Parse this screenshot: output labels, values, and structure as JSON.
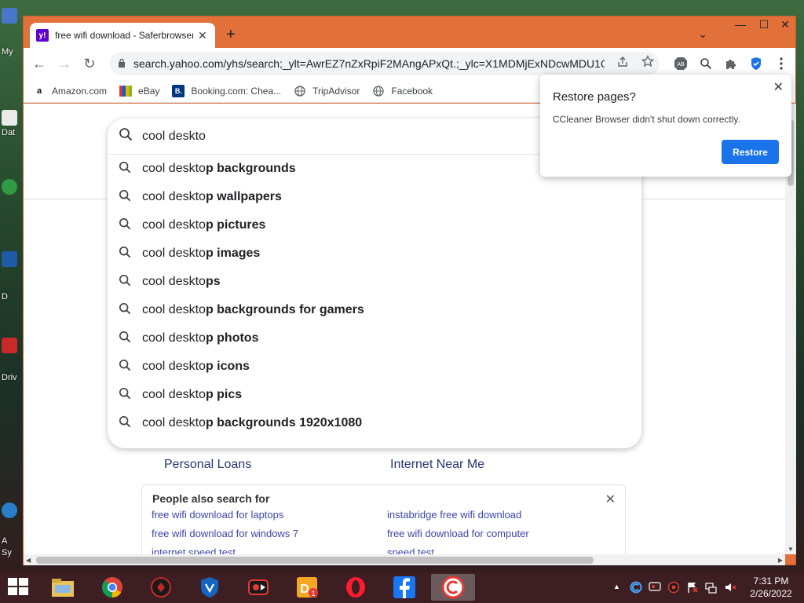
{
  "desktop": {
    "labels": [
      "My",
      "Dat",
      "D",
      "Driv",
      "A",
      "Sy"
    ]
  },
  "tab": {
    "favicon": "y!",
    "title": "free wifi download - Saferbrowser",
    "close": "✕",
    "new_tab": "+"
  },
  "window_controls": {
    "tab_search": "⌄",
    "minimize": "—",
    "maximize": "☐",
    "close": "✕"
  },
  "toolbar": {
    "back": "←",
    "forward": "→",
    "reload": "↻",
    "url": "search.yahoo.com/yhs/search;_ylt=AwrEZ7nZxRpiF2MAngAPxQt.;_ylc=X1MDMjExNDcwMDU1O..."
  },
  "bookmarks": [
    {
      "label": "Amazon.com",
      "icon": "a"
    },
    {
      "label": "eBay",
      "icon": "ebay-icon"
    },
    {
      "label": "Booking.com: Chea...",
      "icon": "B."
    },
    {
      "label": "TripAdvisor",
      "icon": "globe-icon"
    },
    {
      "label": "Facebook",
      "icon": "globe-icon"
    }
  ],
  "search": {
    "value": "cool deskto",
    "suggestions": [
      {
        "prefix": "cool deskto",
        "bold": "p backgrounds"
      },
      {
        "prefix": "cool deskto",
        "bold": "p wallpapers"
      },
      {
        "prefix": "cool deskto",
        "bold": "p pictures"
      },
      {
        "prefix": "cool deskto",
        "bold": "p images"
      },
      {
        "prefix": "cool deskto",
        "bold": "ps"
      },
      {
        "prefix": "cool deskto",
        "bold": "p backgrounds for gamers"
      },
      {
        "prefix": "cool deskto",
        "bold": "p photos"
      },
      {
        "prefix": "cool deskto",
        "bold": "p icons"
      },
      {
        "prefix": "cool deskto",
        "bold": "p pics"
      },
      {
        "prefix": "cool deskto",
        "bold": "p backgrounds 1920x1080"
      }
    ]
  },
  "page": {
    "link_left": "Personal Loans",
    "link_right": "Internet Near Me",
    "people_also_search": {
      "title": "People also search for",
      "close": "✕",
      "items": [
        "free wifi download for laptops",
        "instabridge free wifi download",
        "free wifi download for windows 7",
        "free wifi download for computer",
        "internet speed test",
        "speed test"
      ]
    }
  },
  "popup": {
    "title": "Restore pages?",
    "message": "CCleaner Browser didn't shut down correctly.",
    "button": "Restore",
    "close": "✕"
  },
  "taskbar": {
    "time": "7:31 PM",
    "date": "2/26/2022"
  },
  "colors": {
    "window_frame": "#e2703a",
    "accent_blue": "#1a73e8",
    "yahoo_purple": "#6001d2",
    "link_color": "#26366f",
    "taskbar": "#3d1e22"
  }
}
